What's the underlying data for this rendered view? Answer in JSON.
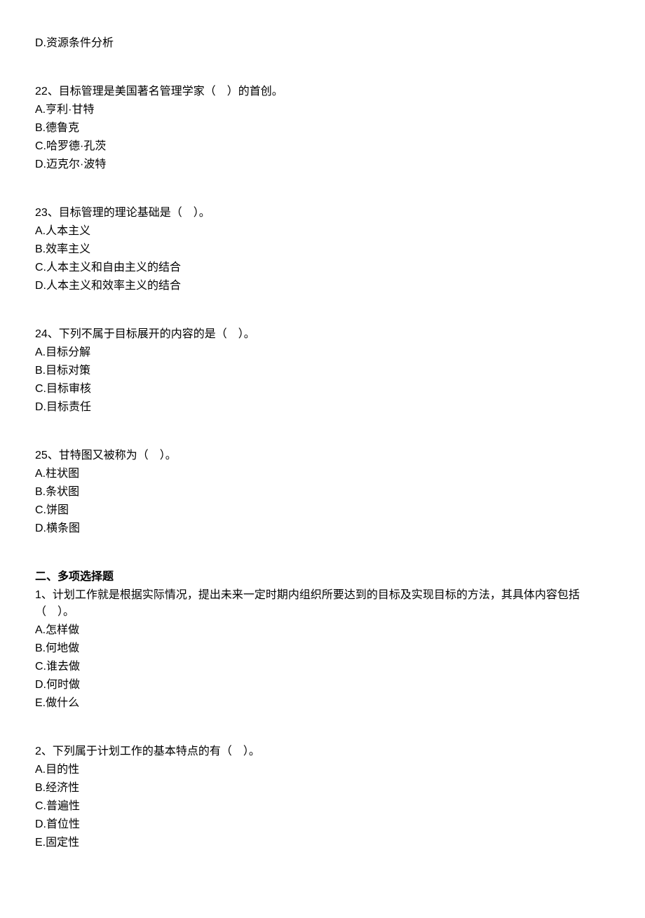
{
  "q21_optD": "D.资源条件分析",
  "q22": {
    "text": "22、目标管理是美国著名管理学家（　）的首创。",
    "optA": "A.亨利·甘特",
    "optB": "B.德鲁克",
    "optC": "C.哈罗德·孔茨",
    "optD": "D.迈克尔·波特"
  },
  "q23": {
    "text": "23、目标管理的理论基础是（　）。",
    "optA": "A.人本主义",
    "optB": "B.效率主义",
    "optC": "C.人本主义和自由主义的结合",
    "optD": "D.人本主义和效率主义的结合"
  },
  "q24": {
    "text": "24、下列不属于目标展开的内容的是（　）。",
    "optA": "A.目标分解",
    "optB": "B.目标对策",
    "optC": "C.目标审核",
    "optD": "D.目标责任"
  },
  "q25": {
    "text": "25、甘特图又被称为（　）。",
    "optA": "A.柱状图",
    "optB": "B.条状图",
    "optC": "C.饼图",
    "optD": "D.横条图"
  },
  "section2_title": "二、多项选择题",
  "mq1": {
    "text": "1、计划工作就是根据实际情况，提出未来一定时期内组织所要达到的目标及实现目标的方法，其具体内容包括（　）。",
    "optA": "A.怎样做",
    "optB": "B.何地做",
    "optC": "C.谁去做",
    "optD": "D.何时做",
    "optE": "E.做什么"
  },
  "mq2": {
    "text": "2、下列属于计划工作的基本特点的有（　）。",
    "optA": "A.目的性",
    "optB": "B.经济性",
    "optC": "C.普遍性",
    "optD": "D.首位性",
    "optE": "E.固定性"
  }
}
